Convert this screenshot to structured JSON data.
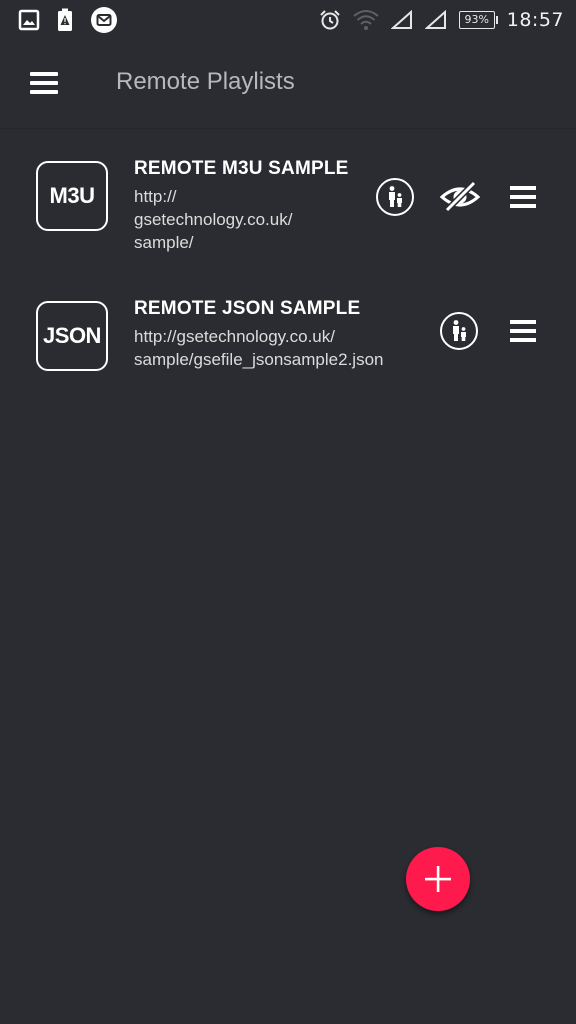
{
  "status_bar": {
    "battery_percent": "93%",
    "time": "18:57",
    "icons": [
      "gallery-icon",
      "battery-warning-icon",
      "mail-icon",
      "alarm-icon",
      "wifi-icon",
      "signal-icon",
      "signal-icon-2"
    ]
  },
  "app_bar": {
    "title": "Remote Playlists",
    "menu_icon": "hamburger-menu-icon"
  },
  "playlists": [
    {
      "logo_text": "M3U",
      "title": "REMOTE M3U SAMPLE",
      "url_lines": [
        "http://",
        "gsetechnology.co.uk/",
        "sample/"
      ],
      "actions": [
        "parental-control-icon",
        "visibility-off-icon",
        "drag-handle-icon"
      ]
    },
    {
      "logo_text": "JSON",
      "title": "REMOTE JSON SAMPLE",
      "url_lines": [
        "http://gsetechnology.co.uk/",
        "sample/gsefile_jsonsample2.json"
      ],
      "actions": [
        "parental-control-icon",
        "drag-handle-icon"
      ]
    }
  ],
  "fab": {
    "icon": "plus-icon"
  },
  "colors": {
    "background": "#2b2c31",
    "fab": "#ff1a4d",
    "title_text": "#b8b8bc",
    "primary_text": "#ffffff"
  }
}
